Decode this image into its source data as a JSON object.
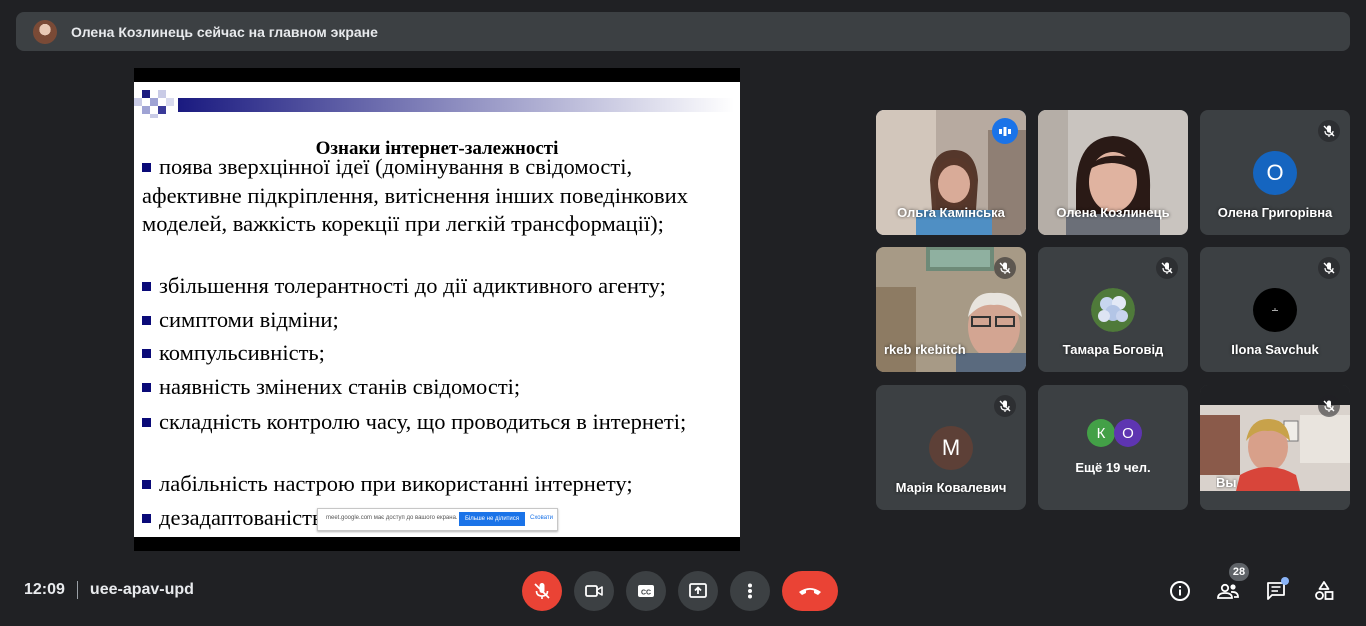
{
  "banner": {
    "presenter_text": "Олена Козлинець сейчас на главном экране"
  },
  "slide": {
    "title": "Ознаки інтернет-залежності",
    "bullets": [
      "поява зверхцінної ідеї (домінування в свідомості, афективне підкріплення, витіснення інших поведінкових моделей, важкість корекції при легкій трансформації);",
      "збільшення толерантності до дії адиктивного агенту;",
      "симптоми відміни;",
      "компульсивність;",
      "наявність змінених станів свідомості;",
      "складність контролю часу, що проводиться в інтернеті;",
      "лабільність настрою при використанні інтернету;",
      "дезадаптованість"
    ],
    "share_notice": {
      "text": "meet.google.com має доступ до вашого екрана.",
      "stop_button": "Більше не ділитися",
      "hide_link": "Сховати"
    }
  },
  "participants": [
    {
      "name": "Ольга Камінська",
      "speaking": true
    },
    {
      "name": "Олена Козлинець"
    },
    {
      "name": "Олена Григорівна",
      "initial": "О",
      "color": "#1565c0",
      "muted": true
    },
    {
      "name": "rkeb rkebitch",
      "muted": true
    },
    {
      "name": "Тамара Боговід",
      "muted": true
    },
    {
      "name": "Ilona Savchuk",
      "muted": true
    },
    {
      "name": "Марія Ковалевич",
      "initial": "М",
      "color": "#5d4037",
      "muted": true
    },
    {
      "more_text": "Ещё 19 чел.",
      "initials": [
        "К",
        "О"
      ],
      "initial_colors": [
        "#43a047",
        "#5e35b1"
      ]
    },
    {
      "name": "Вы",
      "muted": true
    }
  ],
  "bottom": {
    "time": "12:09",
    "meeting_code": "uee-apav-upd",
    "people_count": "28"
  },
  "colors": {
    "end_call": "#ea4335",
    "mic_off": "#ea4335",
    "active_border": "#8ab4f8"
  }
}
